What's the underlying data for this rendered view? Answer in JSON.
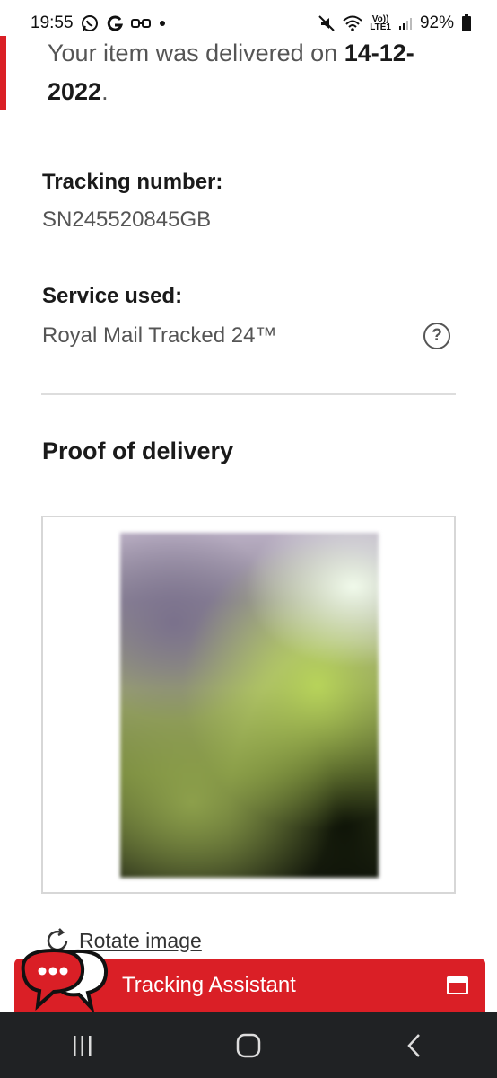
{
  "status_bar": {
    "time": "19:55",
    "battery": "92%",
    "icons": [
      "whatsapp-icon",
      "google-icon",
      "glasses-icon",
      "dot-icon",
      "mute-icon",
      "wifi-icon",
      "volte-icon",
      "signal-icon",
      "battery-icon"
    ],
    "network": "LTE1"
  },
  "delivery": {
    "text": "Your item was delivered on ",
    "date": "14-12-2022",
    "suffix": "."
  },
  "tracking": {
    "label": "Tracking number:",
    "value": "SN245520845GB"
  },
  "service": {
    "label": "Service used:",
    "value": "Royal Mail Tracked 24™",
    "help_icon": "question-mark-icon"
  },
  "proof": {
    "title": "Proof of delivery",
    "rotate_label": "Rotate image"
  },
  "assistant": {
    "label": "Tracking Assistant",
    "chat_icon": "chat-bubbles-icon",
    "window_icon": "window-icon"
  },
  "nav": {
    "icons": [
      "recents-icon",
      "home-icon",
      "back-icon"
    ]
  },
  "colors": {
    "brand_red": "#da1f26",
    "nav_bg": "#202224"
  }
}
